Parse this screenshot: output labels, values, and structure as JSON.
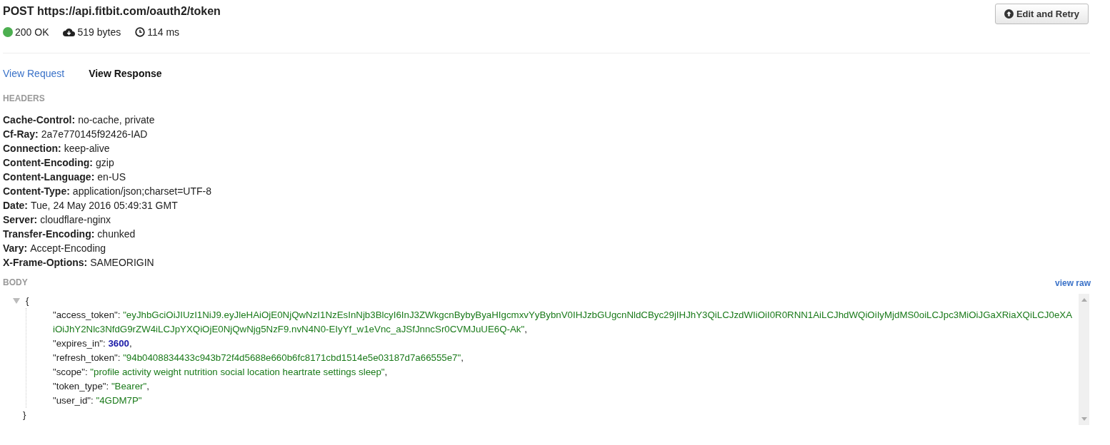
{
  "request": {
    "method": "POST",
    "url": "https://api.fitbit.com/oauth2/token"
  },
  "status": {
    "text": "200 OK",
    "color": "#4caf50"
  },
  "size": "519 bytes",
  "time": "114 ms",
  "edit_button": "Edit and Retry",
  "tabs": [
    {
      "label": "View Request",
      "selected": false
    },
    {
      "label": "View Response",
      "selected": true
    }
  ],
  "headers_title": "HEADERS",
  "headers": [
    {
      "name": "Cache-Control:",
      "value": "no-cache, private"
    },
    {
      "name": "Cf-Ray:",
      "value": "2a7e770145f92426-IAD"
    },
    {
      "name": "Connection:",
      "value": "keep-alive"
    },
    {
      "name": "Content-Encoding:",
      "value": "gzip"
    },
    {
      "name": "Content-Language:",
      "value": "en-US"
    },
    {
      "name": "Content-Type:",
      "value": "application/json;charset=UTF-8"
    },
    {
      "name": "Date:",
      "value": "Tue, 24 May 2016 05:49:31 GMT"
    },
    {
      "name": "Server:",
      "value": "cloudflare-nginx"
    },
    {
      "name": "Transfer-Encoding:",
      "value": "chunked"
    },
    {
      "name": "Vary:",
      "value": "Accept-Encoding"
    },
    {
      "name": "X-Frame-Options:",
      "value": "SAMEORIGIN"
    }
  ],
  "body_title": "BODY",
  "view_raw": "view raw",
  "body": {
    "expanded": true,
    "open": "{",
    "close": "}",
    "entries": [
      {
        "key": "\"access_token\":",
        "value": "\"eyJhbGciOiJIUzI1NiJ9.eyJleHAiOjE0NjQwNzI1NzEsInNjb3BlcyI6InJ3ZWkgcnBybyByaHIgcmxvYyBybnV0IHJzbGUgcnNldCByc29jIHJhY3QiLCJzdWIiOiI0R0RNN1AiLCJhdWQiOiIyMjdMS0oiLCJpc3MiOiJGaXRiaXQiLCJ0eXAiOiJhY2Nlc3NfdG9rZW4iLCJpYXQiOjE0NjQwNjg5NzF9.nvN4N0-EIyYf_w1eVnc_aJSfJnncSr0CVMJuUE6Q-Ak\"",
        "kind": "string",
        "separator": ","
      },
      {
        "key": "\"expires_in\":",
        "value": "3600",
        "kind": "number",
        "separator": ","
      },
      {
        "key": "\"refresh_token\":",
        "value": "\"94b0408834433c943b72f4d5688e660b6fc8171cbd1514e5e03187d7a66555e7\"",
        "kind": "string",
        "separator": ","
      },
      {
        "key": "\"scope\":",
        "value": "\"profile activity weight nutrition social location heartrate settings sleep\"",
        "kind": "string",
        "separator": ","
      },
      {
        "key": "\"token_type\":",
        "value": "\"Bearer\"",
        "kind": "string",
        "separator": ","
      },
      {
        "key": "\"user_id\":",
        "value": "\"4GDM7P\"",
        "kind": "string"
      }
    ]
  }
}
